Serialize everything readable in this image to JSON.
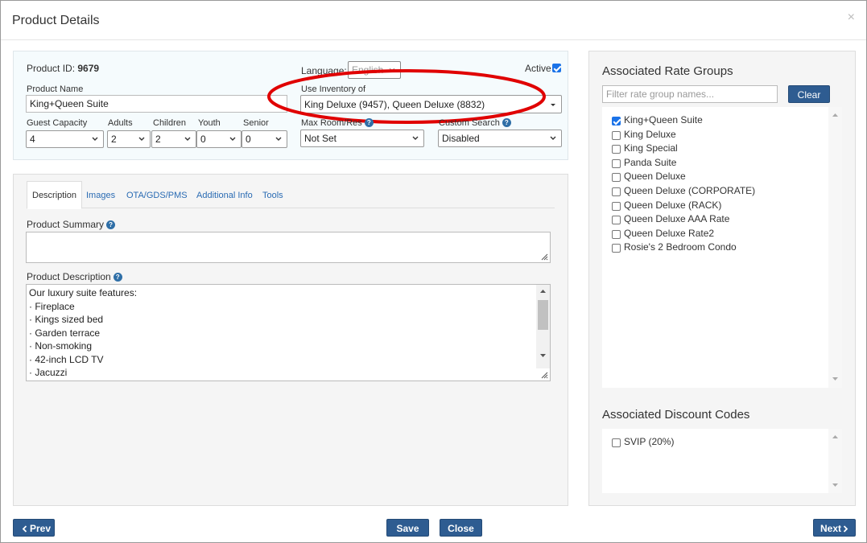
{
  "modal": {
    "title": "Product Details",
    "close_glyph": "×"
  },
  "top": {
    "product_id_label": "Product ID:",
    "product_id_value": "9679",
    "language_label": "Language:",
    "language_value": "English",
    "active_label": "Active",
    "active_checked": true,
    "product_name_label": "Product Name",
    "product_name_value": "King+Queen Suite",
    "use_inventory_label": "Use Inventory of",
    "use_inventory_value": "King Deluxe (9457), Queen Deluxe (8832)",
    "guest_capacity_label": "Guest Capacity",
    "guest_capacity_value": "4",
    "adults_label": "Adults",
    "adults_value": "2",
    "children_label": "Children",
    "children_value": "2",
    "youth_label": "Youth",
    "youth_value": "0",
    "senior_label": "Senior",
    "senior_value": "0",
    "max_room_label": "Max Room/Res",
    "max_room_value": "Not Set",
    "custom_search_label": "Custom Search",
    "custom_search_value": "Disabled",
    "highlight_color": "#e00000"
  },
  "tabs": [
    "Description",
    "Images",
    "OTA/GDS/PMS",
    "Additional Info",
    "Tools"
  ],
  "description": {
    "summary_label": "Product Summary",
    "summary_value": "",
    "desc_label": "Product Description",
    "lines": [
      "Our luxury suite features:",
      " · Fireplace",
      " · Kings sized bed",
      " · Garden terrace",
      " · Non-smoking",
      " · 42-inch LCD TV",
      " · Jacuzzi"
    ]
  },
  "rate_groups": {
    "title": "Associated Rate Groups",
    "filter_placeholder": "Filter rate group names...",
    "clear_label": "Clear",
    "items": [
      {
        "label": "King+Queen Suite",
        "checked": true
      },
      {
        "label": "King Deluxe",
        "checked": false
      },
      {
        "label": "King Special",
        "checked": false
      },
      {
        "label": "Panda Suite",
        "checked": false
      },
      {
        "label": "Queen Deluxe",
        "checked": false
      },
      {
        "label": "Queen Deluxe (CORPORATE)",
        "checked": false
      },
      {
        "label": "Queen Deluxe (RACK)",
        "checked": false
      },
      {
        "label": "Queen Deluxe AAA Rate",
        "checked": false
      },
      {
        "label": "Queen Deluxe Rate2",
        "checked": false
      },
      {
        "label": "Rosie's 2 Bedroom Condo",
        "checked": false
      }
    ]
  },
  "discount_codes": {
    "title": "Associated Discount Codes",
    "items": [
      {
        "label": "SVIP (20%)",
        "checked": false
      }
    ]
  },
  "footer": {
    "prev_label": "Prev",
    "save_label": "Save",
    "close_label": "Close",
    "next_label": "Next"
  },
  "colors": {
    "button_blue": "#2e5c91",
    "link_blue": "#2a6bb3",
    "checkbox_blue": "#1b73e8"
  }
}
